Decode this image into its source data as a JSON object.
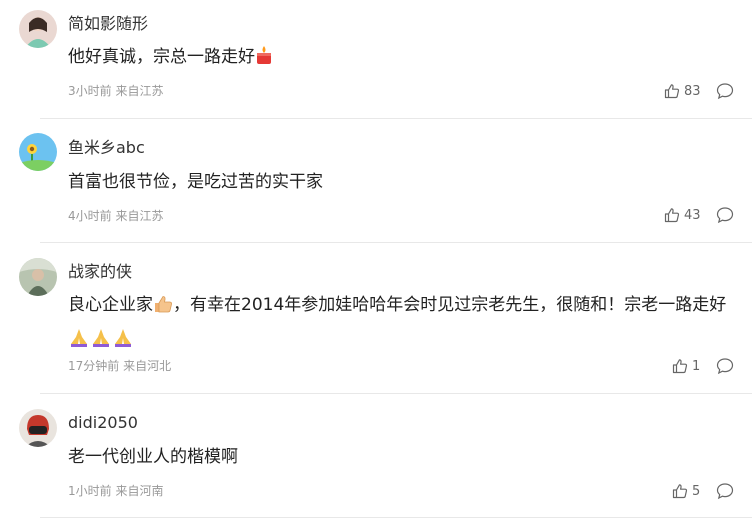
{
  "comments": [
    {
      "username": "简如影随形",
      "text": "他好真诚，宗总一路走好",
      "emojis": [
        "candle-emoji"
      ],
      "meta": "3小时前 来自江苏",
      "likes": "83",
      "avatar_color": "#c9a7a2"
    },
    {
      "username": "鱼米乡abc",
      "text": "首富也很节俭，是吃过苦的实干家",
      "emojis": [],
      "meta": "4小时前 来自江苏",
      "likes": "43",
      "avatar_color": "#5fb3e8"
    },
    {
      "username": "战家的侠",
      "text_part1": "良心企业家",
      "text_part2": "，有幸在2014年参加娃哈哈年会时见过宗老先生，很随和！宗老一路走好",
      "emojis": [
        "thumbs-up-emoji",
        "pray-emoji",
        "pray-emoji",
        "pray-emoji"
      ],
      "meta": "17分钟前 来自河北",
      "likes": "1",
      "avatar_color": "#8a9a7a"
    },
    {
      "username": "didi2050",
      "text": "老一代创业人的楷模啊",
      "emojis": [],
      "meta": "1小时前 来自河南",
      "likes": "5",
      "avatar_color": "#b33a2e"
    }
  ],
  "colors": {
    "text": "#222222",
    "meta": "#999999",
    "divider": "#e8e8e8"
  }
}
